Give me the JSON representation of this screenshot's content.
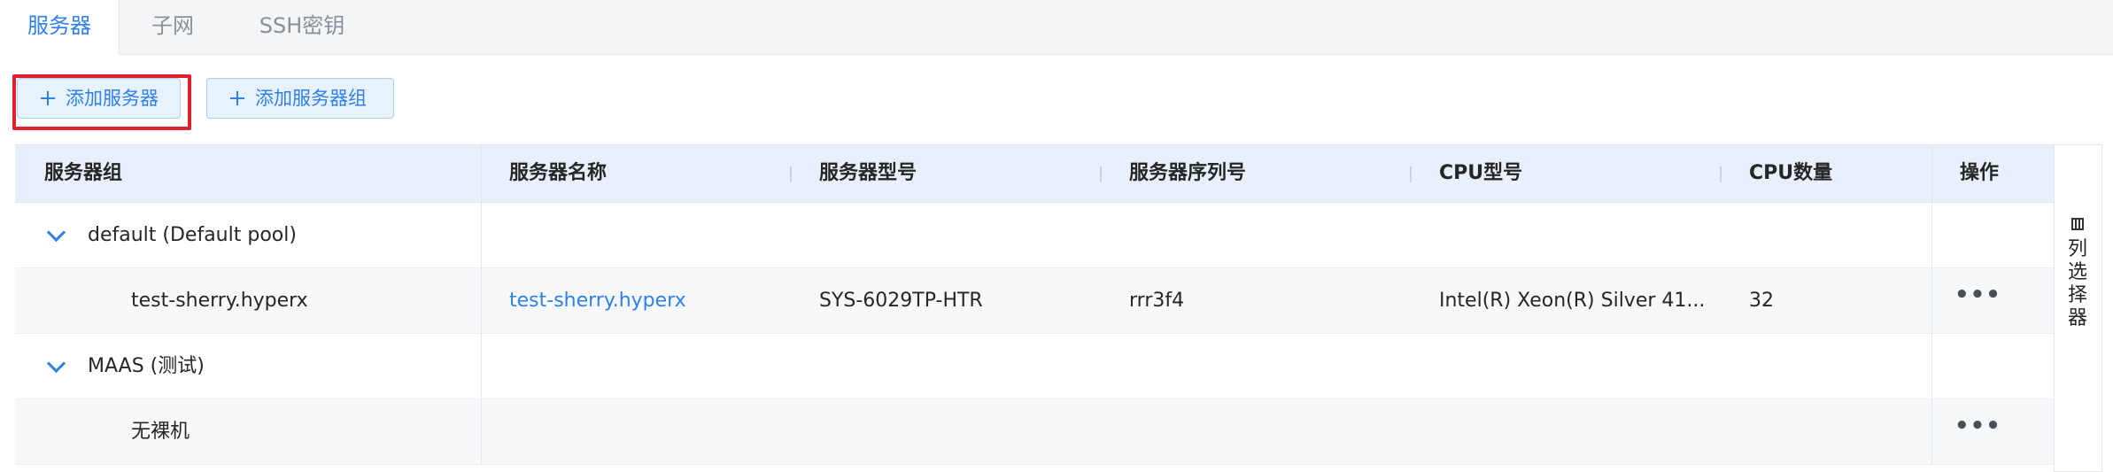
{
  "tabs": [
    {
      "label": "服务器",
      "active": true
    },
    {
      "label": "子网",
      "active": false
    },
    {
      "label": "SSH密钥",
      "active": false
    }
  ],
  "toolbar": {
    "add_server_label": "添加服务器",
    "add_server_group_label": "添加服务器组"
  },
  "table": {
    "headers": {
      "group": "服务器组",
      "name": "服务器名称",
      "model": "服务器型号",
      "serial": "服务器序列号",
      "cpu_model": "CPU型号",
      "cpu_count": "CPU数量",
      "actions": "操作"
    },
    "rows": [
      {
        "type": "group",
        "label": "default (Default pool)"
      },
      {
        "type": "server",
        "group_cell": "test-sherry.hyperx",
        "name": "test-sherry.hyperx",
        "model": "SYS-6029TP-HTR",
        "serial": "rrr3f4",
        "cpu_model": "Intel(R) Xeon(R) Silver 41...",
        "cpu_count": "32",
        "more": "•••"
      },
      {
        "type": "group",
        "label": "MAAS (测试)"
      },
      {
        "type": "server",
        "group_cell": "无裸机",
        "more": "•••"
      }
    ]
  },
  "column_selector": {
    "label": "列选择器",
    "icon": "columns-icon"
  },
  "colors": {
    "accent": "#2f80ed",
    "highlight": "#e0202c",
    "header_bg": "#e9effc"
  }
}
